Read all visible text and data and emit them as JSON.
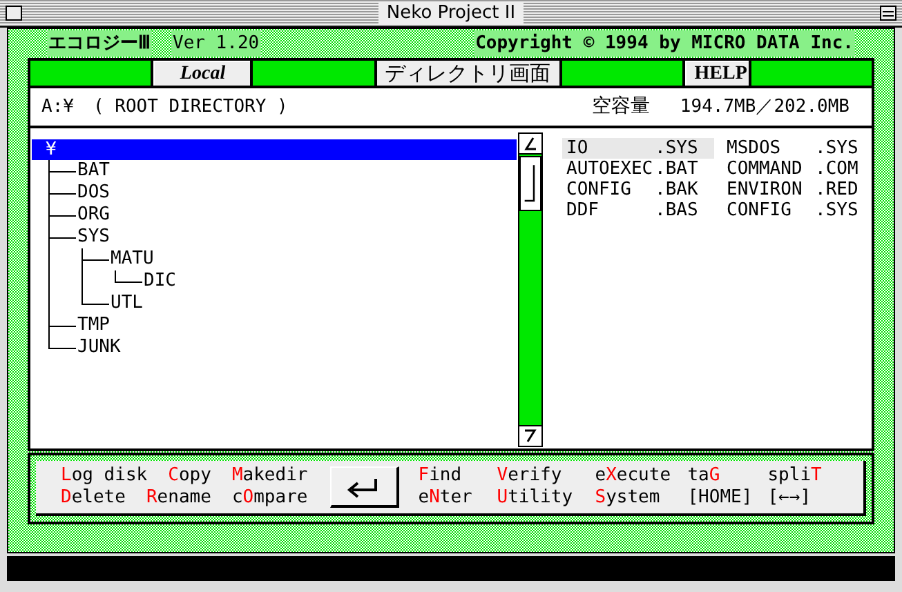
{
  "window": {
    "title": "Neko Project II"
  },
  "header": {
    "app_name": "エコロジーⅢ",
    "version": "Ver 1.20",
    "copyright": "Copyright © 1994 by MICRO DATA Inc."
  },
  "toolbar": [
    {
      "kind": "bar"
    },
    {
      "kind": "button",
      "label": "Local",
      "italic": true
    },
    {
      "kind": "bar"
    },
    {
      "kind": "caption",
      "label": "ディレクトリ画面"
    },
    {
      "kind": "bar"
    },
    {
      "kind": "button",
      "label": "HELP",
      "italic": false
    },
    {
      "kind": "bar"
    }
  ],
  "path_bar": {
    "drive": "A:¥",
    "directory": "( ROOT DIRECTORY )",
    "free_space_label": "空容量",
    "free_space": "194.7MB／202.0MB"
  },
  "tree": {
    "label": "¥",
    "selected": true,
    "children": [
      {
        "label": "BAT",
        "selected": false
      },
      {
        "label": "DOS",
        "selected": false
      },
      {
        "label": "ORG",
        "selected": false
      },
      {
        "label": "SYS",
        "selected": false,
        "children": [
          {
            "label": "MATU",
            "selected": false,
            "children": [
              {
                "label": "DIC",
                "selected": false
              }
            ]
          },
          {
            "label": "UTL",
            "selected": false
          }
        ]
      },
      {
        "label": "TMP",
        "selected": false
      },
      {
        "label": "JUNK",
        "selected": false
      }
    ]
  },
  "files": [
    {
      "name": "IO",
      "ext": ".SYS",
      "selected": true
    },
    {
      "name": "MSDOS",
      "ext": ".SYS",
      "selected": false
    },
    {
      "name": "AUTOEXEC",
      "ext": ".BAT",
      "selected": false
    },
    {
      "name": "COMMAND",
      "ext": ".COM",
      "selected": false
    },
    {
      "name": "CONFIG",
      "ext": ".BAK",
      "selected": false
    },
    {
      "name": "ENVIRON",
      "ext": ".RED",
      "selected": false
    },
    {
      "name": "DDF",
      "ext": ".BAS",
      "selected": false
    },
    {
      "name": "CONFIG",
      "ext": ".SYS",
      "selected": false
    }
  ],
  "commands_left": [
    [
      {
        "hotkey": "L",
        "post": "og disk"
      },
      {
        "hotkey": "C",
        "post": "opy"
      },
      {
        "hotkey": "M",
        "post": "akedir"
      }
    ],
    [
      {
        "hotkey": "D",
        "post": "elete"
      },
      {
        "hotkey": "R",
        "post": "ename"
      },
      {
        "pre": "c",
        "hotkey": "O",
        "post": "mpare"
      }
    ]
  ],
  "commands_right": [
    [
      {
        "hotkey": "F",
        "post": "ind"
      },
      {
        "hotkey": "V",
        "post": "erify"
      },
      {
        "pre": "e",
        "hotkey": "X",
        "post": "ecute"
      },
      {
        "pre": "ta",
        "hotkey": "G"
      },
      {
        "pre": "spli",
        "hotkey": "T"
      }
    ],
    [
      {
        "pre": "e",
        "hotkey": "N",
        "post": "ter"
      },
      {
        "hotkey": "U",
        "post": "tility"
      },
      {
        "hotkey": "S",
        "post": "ystem"
      },
      {
        "pre": "[HOME]"
      },
      {
        "pre": "[←→]"
      }
    ]
  ]
}
